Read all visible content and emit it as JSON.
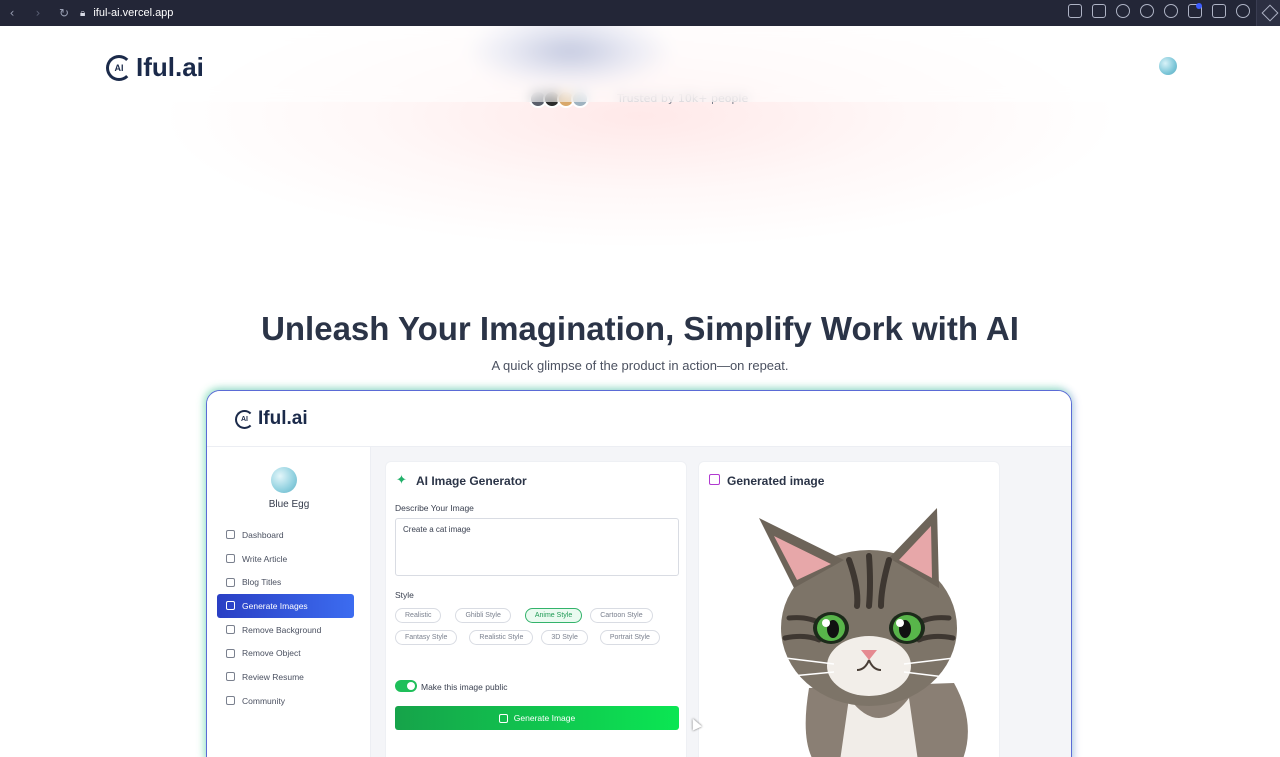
{
  "browser": {
    "url_host": "iful-ai.vercel.app"
  },
  "site": {
    "logo_text": "Iful.ai",
    "logo_badge": "AI",
    "social_proof_text": "Trusted by 10k+ people"
  },
  "hero": {
    "headline": "Unleash Your Imagination, Simplify Work with AI",
    "subline": "A quick glimpse of the product in action—on repeat."
  },
  "demo": {
    "logo_text": "Iful.ai",
    "logo_badge": "AI",
    "user_name": "Blue Egg",
    "menu": [
      {
        "label": "Dashboard",
        "icon": "home-icon"
      },
      {
        "label": "Write Article",
        "icon": "pencil-icon"
      },
      {
        "label": "Blog Titles",
        "icon": "hash-icon"
      },
      {
        "label": "Generate Images",
        "icon": "image-icon",
        "active": true
      },
      {
        "label": "Remove Background",
        "icon": "eraser-icon"
      },
      {
        "label": "Remove Object",
        "icon": "scissors-icon"
      },
      {
        "label": "Review Resume",
        "icon": "file-icon"
      },
      {
        "label": "Community",
        "icon": "users-icon"
      }
    ],
    "generator": {
      "title": "AI Image Generator",
      "describe_label": "Describe Your Image",
      "prompt_value": "Create a cat image",
      "style_label": "Style",
      "styles": [
        "Realistic",
        "Ghibli Style",
        "Anime Style",
        "Cartoon Style",
        "Fantasy Style",
        "Realistic Style",
        "3D Style",
        "Portrait Style"
      ],
      "selected_style": "Anime Style",
      "public_toggle_label": "Make this image public",
      "public_toggle_on": true,
      "button_label": "Generate Image"
    },
    "result": {
      "title": "Generated image"
    }
  },
  "colors": {
    "accent_blue": "#2a3fc4",
    "accent_green": "#16a34a",
    "headline": "#2b3447"
  }
}
